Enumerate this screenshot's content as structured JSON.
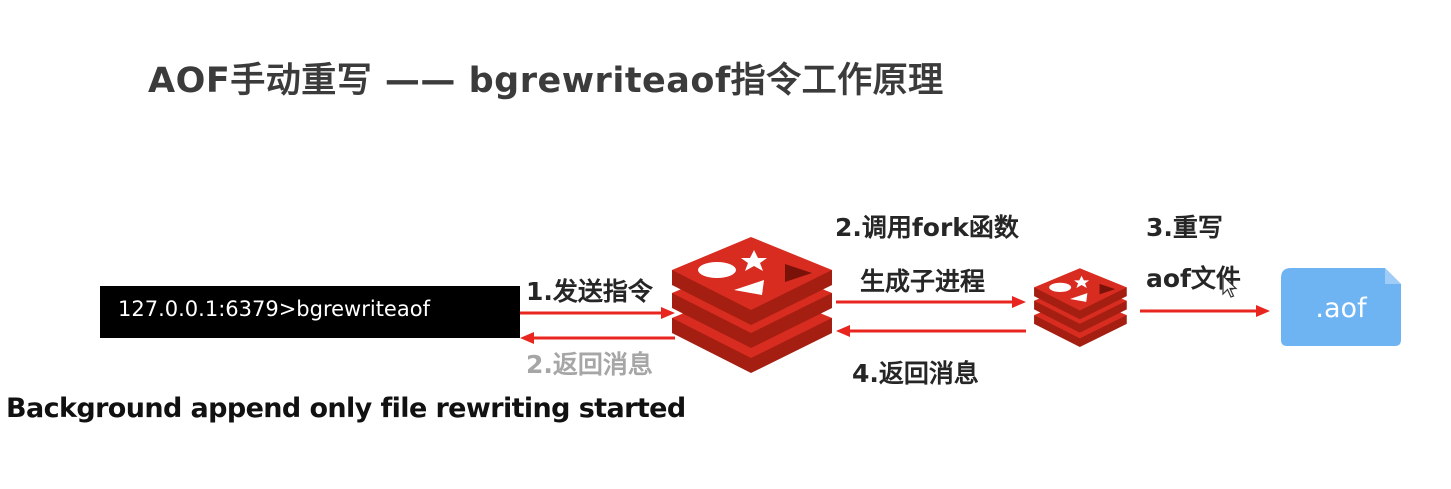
{
  "title": "AOF手动重写 —— bgrewriteaof指令工作原理",
  "terminal": {
    "command": "127.0.0.1:6379>bgrewriteaof"
  },
  "steps": {
    "send_command": "1.发送指令",
    "return_message_client": "2.返回消息",
    "call_fork_line1": "2.调用fork函数",
    "call_fork_line2": "生成子进程",
    "rewrite_line1": "3.重写",
    "rewrite_line2": "aof文件",
    "return_message_child": "4.返回消息"
  },
  "file": {
    "label": ".aof"
  },
  "caption": "Background append only file rewriting started",
  "colors": {
    "arrow": "#e8251f",
    "redis_red": "#d82c20",
    "redis_dark": "#a41e11",
    "file_blue": "#6eb4f3",
    "terminal_bg": "#000000"
  },
  "icons": {
    "main_server": "redis-logo-icon",
    "child_process": "redis-logo-icon",
    "aof_file": "file-icon",
    "cursor": "mouse-pointer-icon"
  }
}
